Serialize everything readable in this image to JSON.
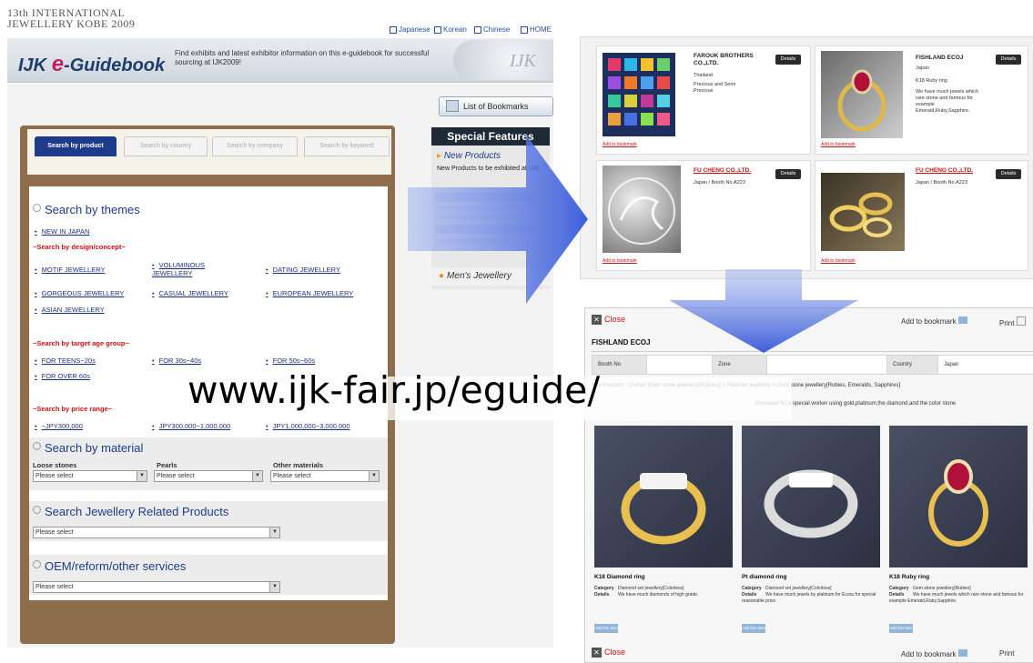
{
  "left": {
    "fair_title_line1": "13th INTERNATIONAL",
    "fair_title_line2": "JEWELLERY KOBE 2009",
    "languages": [
      "Japanese",
      "Korean",
      "Chinese",
      "HOME"
    ],
    "app_title_prefix": "IJK ",
    "app_title_e": "e",
    "app_title_suffix": "-Guidebook",
    "description": "Find exhibits and latest exhibitor information on this e-guidebook for successful sourcing at IJK2009!",
    "logo_text": "IJK",
    "bookmarks_button": "List of Bookmarks",
    "tabs": [
      "Search by product",
      "Search by country",
      "Search by company",
      "Search by keyword"
    ],
    "themes": {
      "heading": "Search by themes",
      "new_item": "NEW IN JAPAN",
      "design_heading": "~Search by design/concept~",
      "design_items": [
        "MOTIF JEWELLERY",
        "VOLUMINOUS JEWELLERY",
        "DATING JEWELLERY",
        "GORGEOUS JEWELLERY",
        "CASUAL JEWELLERY",
        "EUROPEAN JEWELLERY",
        "ASIAN JEWELLERY"
      ],
      "age_heading": "~Search by target age group~",
      "age_items": [
        "FOR TEENS~20s",
        "FOR 30s~40s",
        "FOR 50s~60s",
        "FOR OVER 60s"
      ],
      "price_heading": "~Search by price range~",
      "price_items": [
        "~JPY300,000",
        "JPY300,000~1,000,000",
        "JPY1,000,000~3,000,000"
      ]
    },
    "material": {
      "heading": "Search by material",
      "labels": [
        "Loose stones",
        "Pearls",
        "Other materials"
      ],
      "placeholder": "Please select"
    },
    "related": {
      "heading": "Search Jewellery Related Products",
      "placeholder": "Please select"
    },
    "oem": {
      "heading": "OEM/reform/other services",
      "placeholder": "Please select"
    },
    "special": {
      "heading": "Special Features",
      "new_products": "New Products",
      "new_products_desc": "New Products to be exhibited at IJK!",
      "mens": "Men's Jewellery"
    }
  },
  "right_top": {
    "info_label": "Details",
    "add_bookmark": "Add to bookmark",
    "cards": [
      {
        "company": "FAROUK BROTHERS CO.,LTD.",
        "line1": "Thailand",
        "line2": "Precious and Semi Precious"
      },
      {
        "company": "FISHLAND ECOJ",
        "line1": "Japan",
        "line2": "K18 Ruby ring",
        "line3": "We have much jewels which rare stone and famous for example Emerald,Ruby,Sapphire."
      },
      {
        "company": "FU CHENG CO.,LTD.",
        "line1": "Japan / Booth No.A223"
      },
      {
        "company": "FU CHENG CO.,LTD.",
        "line1": "Japan / Booth No.A223"
      }
    ]
  },
  "right_bottom": {
    "close": "Close",
    "add_bookmark": "Add to bookmark",
    "print": "Print",
    "company": "FISHLAND ECOJ",
    "booth_label": "Booth No",
    "zone_label": "Zone",
    "country_label": "Country",
    "country_value": "Japan",
    "category_line": "Key Products : Overall [Gem stone jewellery(Rubies)] > Platinum jewellery > Gem stone jewellery[Rubies, Emeralds, Sapphires]",
    "details_line": "Produced for a special worker using gold,platinum,the diamond,and the color stone",
    "products": [
      {
        "title": "K18 Diamond ring",
        "category": "Diamond set jewellery[Colorless]",
        "details": "We have much diamonds of high grade."
      },
      {
        "title": "Pt diamond ring",
        "category": "Diamond set jewellery[Colorless]",
        "details": "We have much jewels by platinum for Ecoru for special reasonable price."
      },
      {
        "title": "K18 Ruby ring",
        "category": "Gem stone jewellery[Rubies]",
        "details": "We have much jewels which rare stone and famous for example Emerald,Ruby,Sapphire."
      }
    ],
    "category_label": "Category",
    "details_label": "Details",
    "stamp_text": "Add this item"
  },
  "overlay_url": "www.ijk-fair.jp/eguide/",
  "colors": {
    "accent": "#1d3b8a",
    "red": "#cc1010",
    "arrow": "#3d5fd6",
    "book": "#8d6d4c"
  }
}
